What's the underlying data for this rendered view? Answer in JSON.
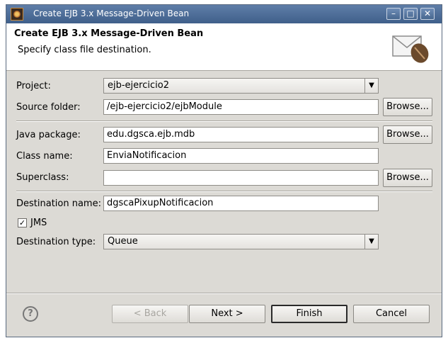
{
  "window": {
    "title": "Create EJB 3.x Message-Driven Bean",
    "minimize_glyph": "–",
    "maximize_glyph": "□",
    "close_glyph": "✕"
  },
  "header": {
    "title": "Create EJB 3.x Message-Driven Bean",
    "subtitle": "Specify class file destination.",
    "icon": "envelope-coffee-bean-icon"
  },
  "form": {
    "project": {
      "label": "Project:",
      "value": "ejb-ejercicio2"
    },
    "source_folder": {
      "label": "Source folder:",
      "value": "/ejb-ejercicio2/ejbModule",
      "browse": "Browse..."
    },
    "java_package": {
      "label": "Java package:",
      "value": "edu.dgsca.ejb.mdb",
      "browse": "Browse..."
    },
    "class_name": {
      "label": "Class name:",
      "value": "EnviaNotificacion"
    },
    "superclass": {
      "label": "Superclass:",
      "value": "",
      "browse": "Browse..."
    },
    "destination_name": {
      "label": "Destination name:",
      "value": "dgscaPixupNotificacion"
    },
    "jms": {
      "label": "JMS",
      "checked": true,
      "check_glyph": "✓"
    },
    "destination_type": {
      "label": "Destination type:",
      "value": "Queue"
    },
    "dropdown_glyph": "▼"
  },
  "footer": {
    "help_glyph": "?",
    "back": "< Back",
    "next": "Next >",
    "finish": "Finish",
    "cancel": "Cancel"
  }
}
